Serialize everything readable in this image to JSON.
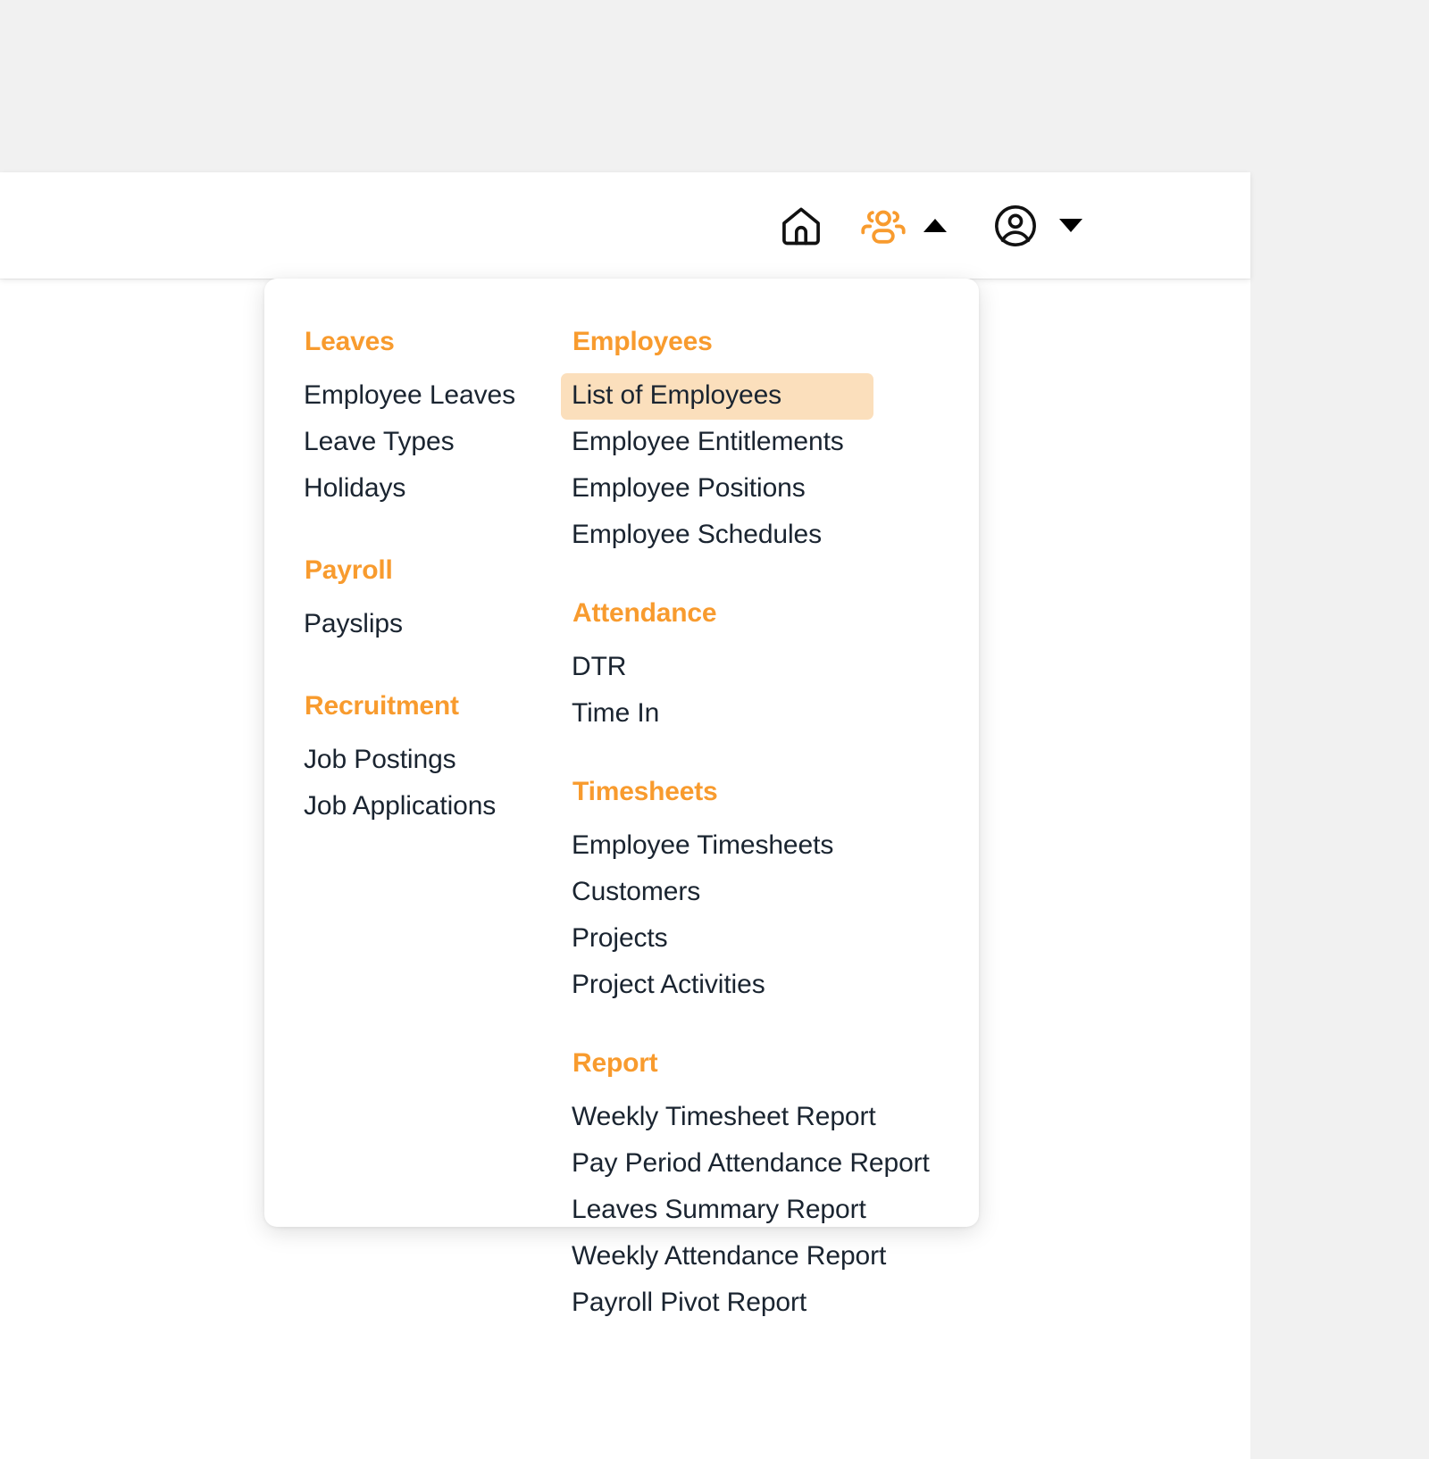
{
  "header": {
    "icons": [
      {
        "name": "home-icon",
        "label": "Home",
        "color": "#111111"
      },
      {
        "name": "users-icon",
        "label": "Employees",
        "color": "#F89B2E"
      },
      {
        "name": "caret-up-icon",
        "label": "Expanded",
        "color": "#000000"
      },
      {
        "name": "account-icon",
        "label": "Account",
        "color": "#111111"
      },
      {
        "name": "caret-down-icon",
        "label": "Account menu",
        "color": "#000000"
      }
    ]
  },
  "colors": {
    "accent": "#F89B2E",
    "active_background": "#FBDFBC",
    "text": "#1A2430",
    "page_background": "#F1F1F1",
    "surface": "#FFFFFF"
  },
  "megamenu": {
    "columns": [
      {
        "groups": [
          {
            "title": "Leaves",
            "items": [
              {
                "label": "Employee Leaves",
                "active": false
              },
              {
                "label": "Leave Types",
                "active": false
              },
              {
                "label": "Holidays",
                "active": false
              }
            ]
          },
          {
            "title": "Payroll",
            "items": [
              {
                "label": "Payslips",
                "active": false
              }
            ]
          },
          {
            "title": "Recruitment",
            "items": [
              {
                "label": "Job Postings",
                "active": false
              },
              {
                "label": "Job Applications",
                "active": false
              }
            ]
          }
        ]
      },
      {
        "groups": [
          {
            "title": "Employees",
            "items": [
              {
                "label": "List of Employees",
                "active": true
              },
              {
                "label": "Employee Entitlements",
                "active": false
              },
              {
                "label": "Employee Positions",
                "active": false
              },
              {
                "label": "Employee Schedules",
                "active": false
              }
            ]
          },
          {
            "title": "Attendance",
            "items": [
              {
                "label": "DTR",
                "active": false
              },
              {
                "label": "Time In",
                "active": false
              }
            ]
          },
          {
            "title": "Timesheets",
            "items": [
              {
                "label": "Employee Timesheets",
                "active": false
              },
              {
                "label": "Customers",
                "active": false
              },
              {
                "label": "Projects",
                "active": false
              },
              {
                "label": "Project Activities",
                "active": false
              }
            ]
          },
          {
            "title": "Report",
            "items": [
              {
                "label": "Weekly Timesheet Report",
                "active": false
              },
              {
                "label": "Pay Period Attendance Report",
                "active": false
              },
              {
                "label": "Leaves Summary Report",
                "active": false
              },
              {
                "label": "Weekly Attendance Report",
                "active": false
              },
              {
                "label": "Payroll Pivot Report",
                "active": false
              }
            ]
          }
        ]
      }
    ]
  }
}
